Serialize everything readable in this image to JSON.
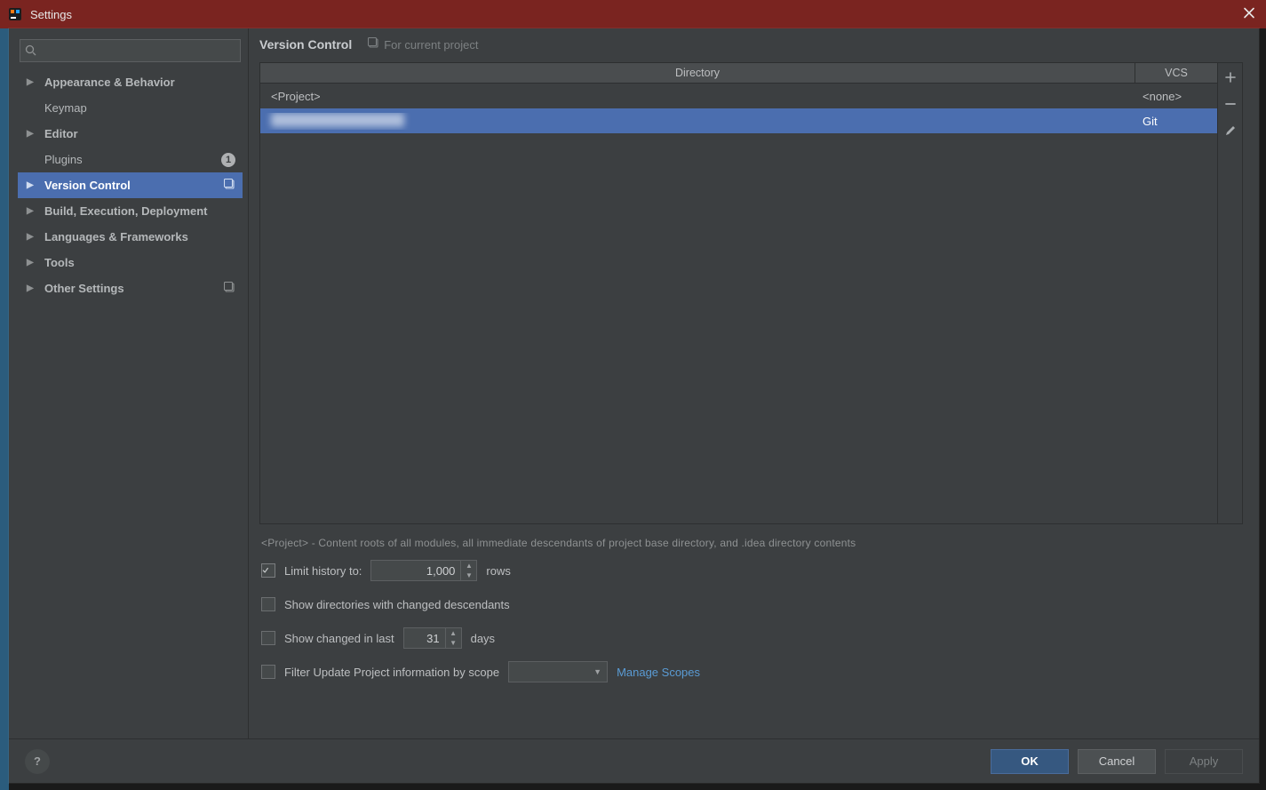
{
  "window": {
    "title": "Settings"
  },
  "sidebar": {
    "search_placeholder": "",
    "items": [
      {
        "label": "Appearance & Behavior",
        "expandable": true
      },
      {
        "label": "Keymap",
        "leaf": true
      },
      {
        "label": "Editor",
        "expandable": true
      },
      {
        "label": "Plugins",
        "leaf": true,
        "badge": "1"
      },
      {
        "label": "Version Control",
        "expandable": true,
        "selected": true,
        "contextual": true
      },
      {
        "label": "Build, Execution, Deployment",
        "expandable": true
      },
      {
        "label": "Languages & Frameworks",
        "expandable": true
      },
      {
        "label": "Tools",
        "expandable": true
      },
      {
        "label": "Other Settings",
        "expandable": true,
        "contextual": true
      }
    ]
  },
  "main": {
    "title": "Version Control",
    "current_project_label": "For current project",
    "table": {
      "columns": {
        "directory": "Directory",
        "vcs": "VCS"
      },
      "rows": [
        {
          "directory": "<Project>",
          "vcs": "<none>"
        },
        {
          "directory": "",
          "vcs": "Git",
          "selected": true
        }
      ]
    },
    "help_text": "<Project> - Content roots of all modules, all immediate descendants of project base directory, and .idea directory contents",
    "options": {
      "limit_history_label": "Limit history to:",
      "limit_history_value": "1,000",
      "limit_history_suffix": "rows",
      "limit_history_checked": true,
      "show_dirs_label": "Show directories with changed descendants",
      "show_dirs_checked": false,
      "show_changed_label": "Show changed in last",
      "show_changed_value": "31",
      "show_changed_suffix": "days",
      "show_changed_checked": false,
      "filter_scope_label": "Filter Update Project information by scope",
      "filter_scope_checked": false,
      "filter_scope_value": "",
      "manage_scopes_label": "Manage Scopes"
    }
  },
  "footer": {
    "ok": "OK",
    "cancel": "Cancel",
    "apply": "Apply"
  }
}
